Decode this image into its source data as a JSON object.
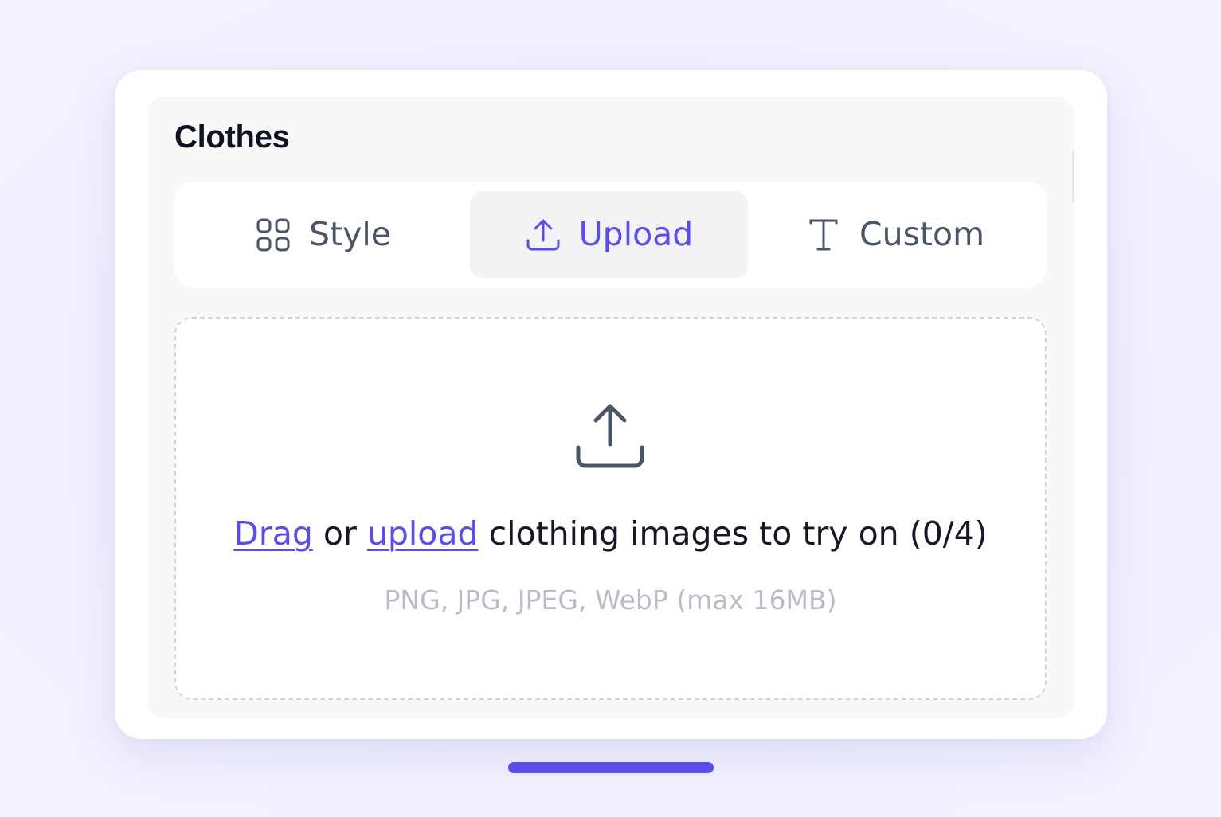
{
  "panel": {
    "title": "Clothes"
  },
  "tabs": [
    {
      "label": "Style",
      "icon": "grid-icon",
      "active": false
    },
    {
      "label": "Upload",
      "icon": "upload-icon",
      "active": true
    },
    {
      "label": "Custom",
      "icon": "text-icon",
      "active": false
    }
  ],
  "dropzone": {
    "icon": "upload-icon",
    "drag_link": "Drag",
    "or_text": " or ",
    "upload_link": "upload",
    "rest_text": " clothing images to try on (0/4)",
    "formats_hint": "PNG, JPG, JPEG, WebP (max 16MB)"
  },
  "colors": {
    "accent": "#5b4ee8",
    "text_primary": "#151827",
    "text_secondary": "#4a5568",
    "hint": "#b8bcc8",
    "background": "#f1f0fd"
  }
}
